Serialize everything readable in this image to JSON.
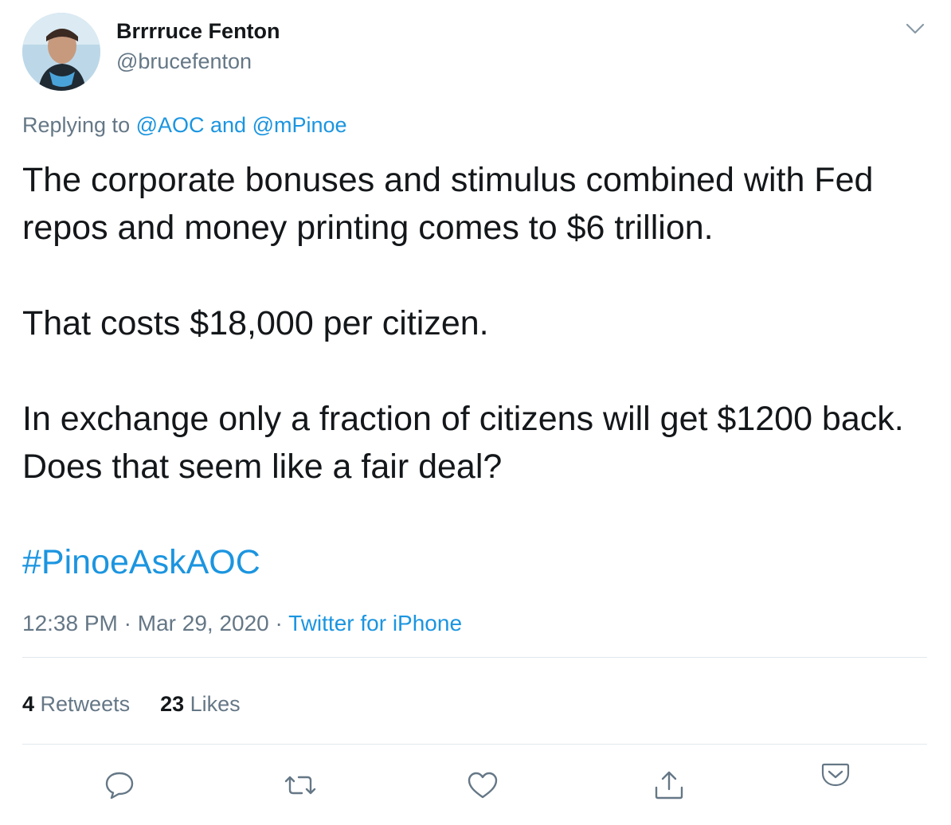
{
  "author": {
    "name": "Brrrruce Fenton",
    "handle": "@brucefenton"
  },
  "reply": {
    "prefix": "Replying to ",
    "mention1": "@AOC",
    "conjunction": " and ",
    "mention2": "@mPinoe"
  },
  "tweet": {
    "paragraph1": "The corporate bonuses and stimulus combined with Fed repos and money printing comes to $6 trillion.",
    "paragraph2": "That costs $18,000 per citizen.",
    "paragraph3": "In exchange only a fraction of citizens will get $1200 back.  Does that seem like a fair deal?",
    "hashtag": "#PinoeAskAOC"
  },
  "meta": {
    "time": "12:38 PM",
    "separator1": " · ",
    "date": "Mar 29, 2020",
    "separator2": " · ",
    "source": "Twitter for iPhone"
  },
  "stats": {
    "retweets_count": "4",
    "retweets_label": " Retweets",
    "likes_count": "23",
    "likes_label": " Likes"
  },
  "icons": {
    "reply": "reply-icon",
    "retweet": "retweet-icon",
    "like": "heart-icon",
    "share": "share-icon",
    "pocket": "pocket-icon",
    "caret": "chevron-down-icon"
  },
  "colors": {
    "link": "#1b95e0",
    "secondary": "#657786",
    "text": "#14171a",
    "divider": "#e1e8ed"
  }
}
